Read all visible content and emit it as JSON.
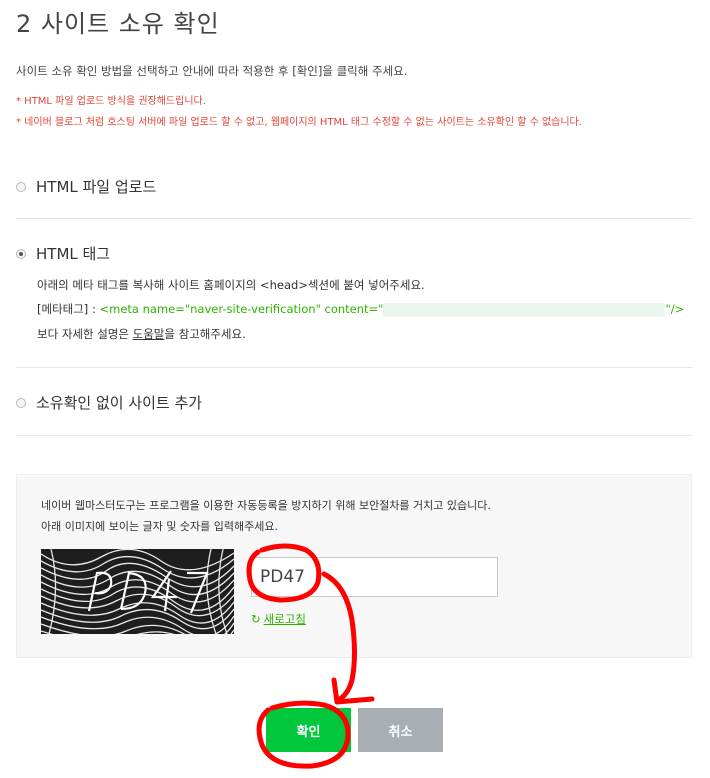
{
  "page": {
    "title": "2 사이트 소유 확인",
    "intro": "사이트 소유 확인 방법을 선택하고 안내에 따라 적용한 후 [확인]을 클릭해 주세요.",
    "notices": [
      "* HTML 파일 업로드 방식을 권장해드립니다.",
      "* 네이버 블로그 처럼 호스팅 서버에 파일 업로드 할 수 없고, 웹페이지의 HTML 태그 수정할 수 없는 사이트는 소유확인 할 수 없습니다."
    ]
  },
  "options": {
    "html_file": {
      "label": "HTML 파일 업로드"
    },
    "html_tag": {
      "label": "HTML 태그",
      "instruction": "아래의 메타 태그를 복사해 사이트 홈페이지의 <head>섹션에 붙여 넣어주세요.",
      "meta_prefix": "[메타태그] : ",
      "meta_code_start": "<meta name=\"naver-site-verification\" content=\"",
      "meta_code_end": "\"/>",
      "help_prefix": "보다 자세한 설명은 ",
      "help_link": "도움말",
      "help_suffix": "을 참고해주세요."
    },
    "no_verify": {
      "label": "소유확인 없이 사이트 추가"
    }
  },
  "selected_option": "html_tag",
  "captcha": {
    "line1": "네이버 웹마스터도구는 프로그램을 이용한 자동등록을 방지하기 위해 보안절차를 거치고 있습니다.",
    "line2": "아래 이미지에 보이는 글자 및 숫자를 입력해주세요.",
    "image_text": "PD47",
    "input_value": "PD47",
    "refresh_label": "새로고침",
    "refresh_icon": "refresh-icon"
  },
  "buttons": {
    "confirm": "확인",
    "cancel": "취소"
  },
  "colors": {
    "green": "#00c73c",
    "notice_red": "#e0443a",
    "annotation_red": "#ff0000",
    "cancel_gray": "#a8aeb4"
  }
}
